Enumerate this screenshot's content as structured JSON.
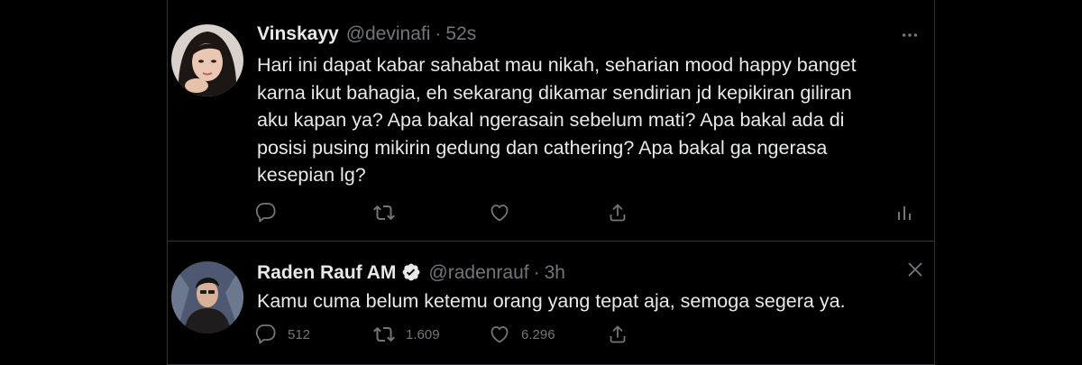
{
  "colors": {
    "background": "#000000",
    "text": "#e7e9ea",
    "muted": "#71767b",
    "divider": "#2f3336",
    "verified_badge": "#e7e9ea"
  },
  "tweet1": {
    "name": "Vinskayy",
    "handle": "@devinafi",
    "dot": "·",
    "time": "52s",
    "text": "Hari ini dapat kabar sahabat mau nikah, seharian mood happy banget\nkarna ikut bahagia, eh sekarang dikamar sendirian jd kepikiran giliran\naku kapan ya? Apa bakal ngerasain sebelum mati? Apa bakal ada di\nposisi pusing mikirin gedung dan cathering? Apa bakal ga ngerasa\nkesepian lg?",
    "icons": {
      "more": "more-horizontal-icon",
      "reply": "reply-icon",
      "retweet": "retweet-icon",
      "like": "heart-icon",
      "share": "share-icon",
      "analytics": "analytics-icon"
    }
  },
  "tweet2": {
    "name": "Raden Rauf AM",
    "handle": "@radenrauf",
    "dot": "·",
    "time": "3h",
    "text": "Kamu cuma belum ketemu orang yang tepat aja, semoga segera ya.",
    "replies": "512",
    "retweets": "1.609",
    "likes": "6.296",
    "icons": {
      "verified": "verified-badge-icon",
      "close": "close-icon",
      "reply": "reply-icon",
      "retweet": "retweet-icon",
      "like": "heart-icon",
      "share": "share-icon"
    }
  }
}
